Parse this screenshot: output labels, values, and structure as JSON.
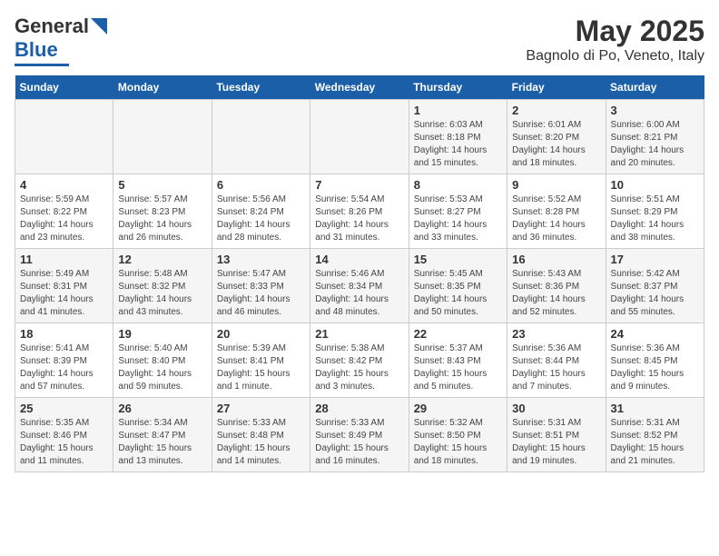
{
  "header": {
    "logo_line1": "General",
    "logo_line2": "Blue",
    "title": "May 2025",
    "subtitle": "Bagnolo di Po, Veneto, Italy"
  },
  "days_of_week": [
    "Sunday",
    "Monday",
    "Tuesday",
    "Wednesday",
    "Thursday",
    "Friday",
    "Saturday"
  ],
  "weeks": [
    [
      {
        "day": "",
        "info": ""
      },
      {
        "day": "",
        "info": ""
      },
      {
        "day": "",
        "info": ""
      },
      {
        "day": "",
        "info": ""
      },
      {
        "day": "1",
        "info": "Sunrise: 6:03 AM\nSunset: 8:18 PM\nDaylight: 14 hours\nand 15 minutes."
      },
      {
        "day": "2",
        "info": "Sunrise: 6:01 AM\nSunset: 8:20 PM\nDaylight: 14 hours\nand 18 minutes."
      },
      {
        "day": "3",
        "info": "Sunrise: 6:00 AM\nSunset: 8:21 PM\nDaylight: 14 hours\nand 20 minutes."
      }
    ],
    [
      {
        "day": "4",
        "info": "Sunrise: 5:59 AM\nSunset: 8:22 PM\nDaylight: 14 hours\nand 23 minutes."
      },
      {
        "day": "5",
        "info": "Sunrise: 5:57 AM\nSunset: 8:23 PM\nDaylight: 14 hours\nand 26 minutes."
      },
      {
        "day": "6",
        "info": "Sunrise: 5:56 AM\nSunset: 8:24 PM\nDaylight: 14 hours\nand 28 minutes."
      },
      {
        "day": "7",
        "info": "Sunrise: 5:54 AM\nSunset: 8:26 PM\nDaylight: 14 hours\nand 31 minutes."
      },
      {
        "day": "8",
        "info": "Sunrise: 5:53 AM\nSunset: 8:27 PM\nDaylight: 14 hours\nand 33 minutes."
      },
      {
        "day": "9",
        "info": "Sunrise: 5:52 AM\nSunset: 8:28 PM\nDaylight: 14 hours\nand 36 minutes."
      },
      {
        "day": "10",
        "info": "Sunrise: 5:51 AM\nSunset: 8:29 PM\nDaylight: 14 hours\nand 38 minutes."
      }
    ],
    [
      {
        "day": "11",
        "info": "Sunrise: 5:49 AM\nSunset: 8:31 PM\nDaylight: 14 hours\nand 41 minutes."
      },
      {
        "day": "12",
        "info": "Sunrise: 5:48 AM\nSunset: 8:32 PM\nDaylight: 14 hours\nand 43 minutes."
      },
      {
        "day": "13",
        "info": "Sunrise: 5:47 AM\nSunset: 8:33 PM\nDaylight: 14 hours\nand 46 minutes."
      },
      {
        "day": "14",
        "info": "Sunrise: 5:46 AM\nSunset: 8:34 PM\nDaylight: 14 hours\nand 48 minutes."
      },
      {
        "day": "15",
        "info": "Sunrise: 5:45 AM\nSunset: 8:35 PM\nDaylight: 14 hours\nand 50 minutes."
      },
      {
        "day": "16",
        "info": "Sunrise: 5:43 AM\nSunset: 8:36 PM\nDaylight: 14 hours\nand 52 minutes."
      },
      {
        "day": "17",
        "info": "Sunrise: 5:42 AM\nSunset: 8:37 PM\nDaylight: 14 hours\nand 55 minutes."
      }
    ],
    [
      {
        "day": "18",
        "info": "Sunrise: 5:41 AM\nSunset: 8:39 PM\nDaylight: 14 hours\nand 57 minutes."
      },
      {
        "day": "19",
        "info": "Sunrise: 5:40 AM\nSunset: 8:40 PM\nDaylight: 14 hours\nand 59 minutes."
      },
      {
        "day": "20",
        "info": "Sunrise: 5:39 AM\nSunset: 8:41 PM\nDaylight: 15 hours\nand 1 minute."
      },
      {
        "day": "21",
        "info": "Sunrise: 5:38 AM\nSunset: 8:42 PM\nDaylight: 15 hours\nand 3 minutes."
      },
      {
        "day": "22",
        "info": "Sunrise: 5:37 AM\nSunset: 8:43 PM\nDaylight: 15 hours\nand 5 minutes."
      },
      {
        "day": "23",
        "info": "Sunrise: 5:36 AM\nSunset: 8:44 PM\nDaylight: 15 hours\nand 7 minutes."
      },
      {
        "day": "24",
        "info": "Sunrise: 5:36 AM\nSunset: 8:45 PM\nDaylight: 15 hours\nand 9 minutes."
      }
    ],
    [
      {
        "day": "25",
        "info": "Sunrise: 5:35 AM\nSunset: 8:46 PM\nDaylight: 15 hours\nand 11 minutes."
      },
      {
        "day": "26",
        "info": "Sunrise: 5:34 AM\nSunset: 8:47 PM\nDaylight: 15 hours\nand 13 minutes."
      },
      {
        "day": "27",
        "info": "Sunrise: 5:33 AM\nSunset: 8:48 PM\nDaylight: 15 hours\nand 14 minutes."
      },
      {
        "day": "28",
        "info": "Sunrise: 5:33 AM\nSunset: 8:49 PM\nDaylight: 15 hours\nand 16 minutes."
      },
      {
        "day": "29",
        "info": "Sunrise: 5:32 AM\nSunset: 8:50 PM\nDaylight: 15 hours\nand 18 minutes."
      },
      {
        "day": "30",
        "info": "Sunrise: 5:31 AM\nSunset: 8:51 PM\nDaylight: 15 hours\nand 19 minutes."
      },
      {
        "day": "31",
        "info": "Sunrise: 5:31 AM\nSunset: 8:52 PM\nDaylight: 15 hours\nand 21 minutes."
      }
    ]
  ]
}
